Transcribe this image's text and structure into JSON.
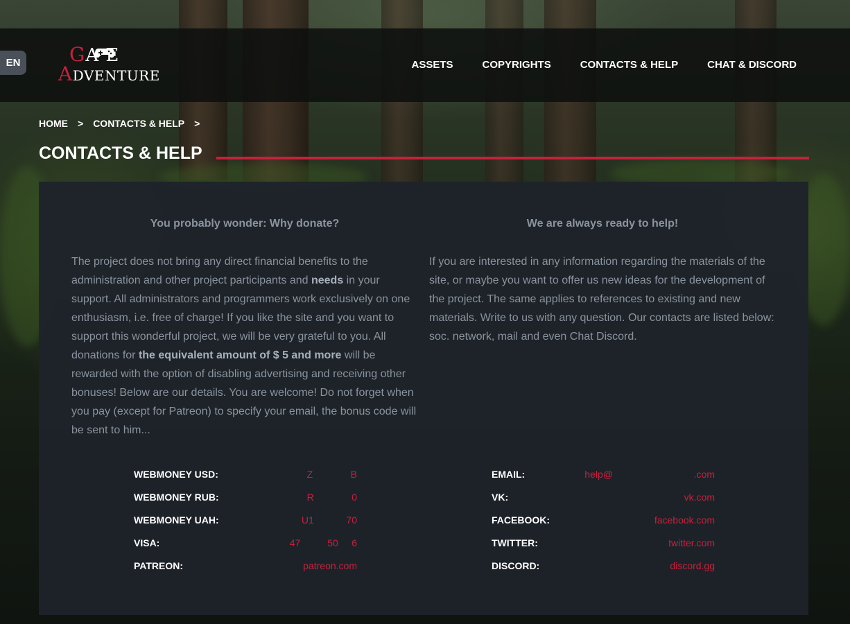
{
  "header": {
    "lang": "EN",
    "logo_line1_first": "G",
    "logo_line1_rest": "A  E",
    "logo_line2_first": "A",
    "logo_line2_rest": "DVENTURE",
    "nav": [
      "ASSETS",
      "COPYRIGHTS",
      "CONTACTS & HELP",
      "CHAT & DISCORD"
    ]
  },
  "breadcrumb": {
    "items": [
      "HOME",
      "CONTACTS & HELP"
    ],
    "separator": ">"
  },
  "page_title": "CONTACTS & HELP",
  "donate": {
    "heading": "You probably wonder: Why donate?",
    "text_1": "The project does not bring any direct financial benefits to the administration and other project participants and ",
    "text_bold_1": "needs",
    "text_2": " in your support. All administrators and programmers work exclusively on one enthusiasm, i.e. free of charge! If you like the site and you want to support this wonderful project, we will be very grateful to you. All donations for ",
    "text_bold_2": "the equivalent amount of $ 5 and more",
    "text_3": " will be rewarded with the option of disabling advertising and receiving other bonuses! Below are our details. You are welcome! Do not forget when you pay (except for Patreon) to specify your email, the bonus code will be sent to him..."
  },
  "help": {
    "heading": "We are always ready to help!",
    "text": "If you are interested in any information regarding the materials of the site, or maybe you want to offer us new ideas for the development of the project. The same applies to references to existing and new materials. Write to us with any question. Our contacts are listed below: soc. network, mail and even Chat Discord."
  },
  "payments": [
    {
      "label": "WEBMONEY USD:",
      "value": "Z              B"
    },
    {
      "label": "WEBMONEY RUB:",
      "value": "R              0"
    },
    {
      "label": "WEBMONEY UAH:",
      "value": "U1            70"
    },
    {
      "label": "VISA:",
      "value": "47          50     6"
    },
    {
      "label": "PATREON:",
      "value": "patreon.com"
    }
  ],
  "contacts": [
    {
      "label": "EMAIL:",
      "value": "help@                              .com"
    },
    {
      "label": "VK:",
      "value": "vk.com"
    },
    {
      "label": "FACEBOOK:",
      "value": "facebook.com"
    },
    {
      "label": "TWITTER:",
      "value": "twitter.com"
    },
    {
      "label": "DISCORD:",
      "value": "discord.gg"
    }
  ],
  "colors": {
    "accent": "#c8203b",
    "panel": "#1e232a",
    "muted_text": "#8a939e"
  }
}
